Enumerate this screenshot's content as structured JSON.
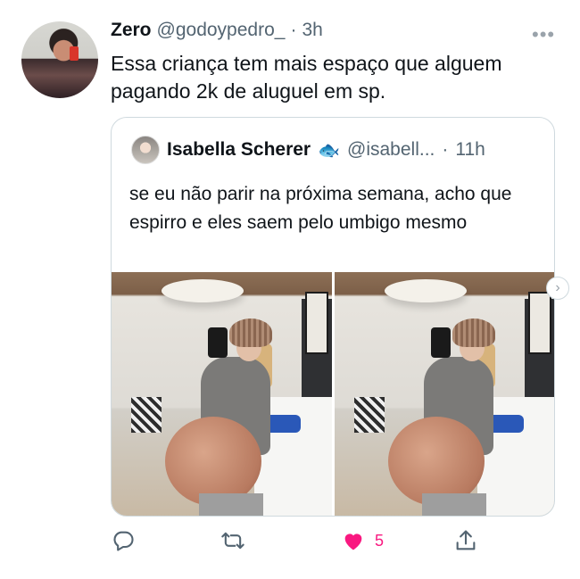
{
  "tweet": {
    "author_name": "Zero",
    "author_handle": "@godoypedro_",
    "separator": "·",
    "time": "3h",
    "more_label": "•••",
    "text": "Essa criança tem mais espaço que alguem pagando 2k de aluguel em sp."
  },
  "quoted": {
    "author_name": "Isabella Scherer",
    "emoji": "🐟",
    "author_handle": "@isabell...",
    "separator": "·",
    "time": "11h",
    "text": "se eu não parir na próxima semana, acho que espirro e eles saem pelo umbigo mesmo"
  },
  "actions": {
    "like_count": "5",
    "liked": true,
    "like_color": "#f91880"
  },
  "icons": {
    "reply": "reply-icon",
    "retweet": "retweet-icon",
    "like": "heart-icon",
    "share": "share-icon",
    "next": "chevron-right-icon"
  },
  "colors": {
    "text_primary": "#0f1419",
    "text_secondary": "#536471",
    "border": "#cfd9de"
  }
}
